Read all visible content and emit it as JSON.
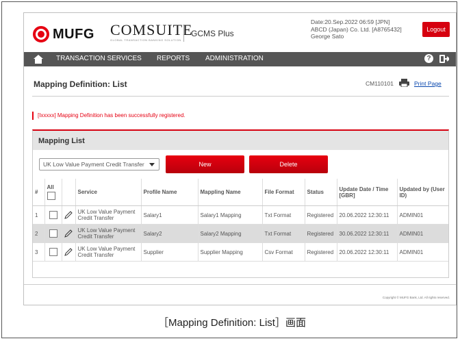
{
  "header": {
    "brand": "MUFG",
    "product": "COMSUITE",
    "product_sub": "GLOBAL TRANSACTION BANKING SOLUTION",
    "service": "GCMS Plus",
    "date_line": "Date:20.Sep.2022 06:59 [JPN]",
    "company_line": "ABCD (Japan) Co. Ltd. [A8765432]",
    "user_line": "George Sato",
    "logout_label": "Logout"
  },
  "nav": {
    "items": [
      "TRANSACTION SERVICES",
      "REPORTS",
      "ADMINISTRATION"
    ],
    "help_glyph": "?"
  },
  "page": {
    "title": "Mapping Definition: List",
    "screen_id": "CM110101",
    "print_label": "Print Page",
    "message": "[Ixxxxx] Mapping Definition has been successfully registered."
  },
  "panel": {
    "title": "Mapping List",
    "select_value": "UK Low Value Payment Credit Transfer",
    "new_label": "New",
    "delete_label": "Delete",
    "columns": {
      "num": "#",
      "all": "All",
      "service": "Service",
      "profile": "Profile Name",
      "mapping": "Mappling Name",
      "format": "File Format",
      "status": "Status",
      "update": "Update Date / Time [GBR]",
      "updated_by": "Updated by (User ID)"
    },
    "rows": [
      {
        "num": "1",
        "service": "UK Low Value Payment Credit Transfer",
        "profile": "Salary1",
        "mapping": "Salary1 Mapping",
        "format": "Txt Format",
        "status": "Registered",
        "update": "20.06.2022 12:30:11",
        "updated_by": "ADMIN01"
      },
      {
        "num": "2",
        "service": "UK Low Value Payment Credit Transfer",
        "profile": "Salary2",
        "mapping": "Salary2 Mapping",
        "format": "Txt Format",
        "status": "Registered",
        "update": "30.06.2022 12:30:11",
        "updated_by": "ADMIN01"
      },
      {
        "num": "3",
        "service": "UK Low Value Payment Credit Transfer",
        "profile": "Supplier",
        "mapping": "Supplier Mapping",
        "format": "Csv Format",
        "status": "Registered",
        "update": "20.06.2022 12:30:11",
        "updated_by": "ADMIN01"
      }
    ]
  },
  "footer": {
    "copyright": "Copyright © MUFG Bank, Ltd. All rights reserved."
  },
  "caption": "［Mapping Definition: List］画面",
  "colors": {
    "brand_red": "#e60012",
    "nav_gray": "#555555",
    "row_alt": "#dcdcdc"
  }
}
